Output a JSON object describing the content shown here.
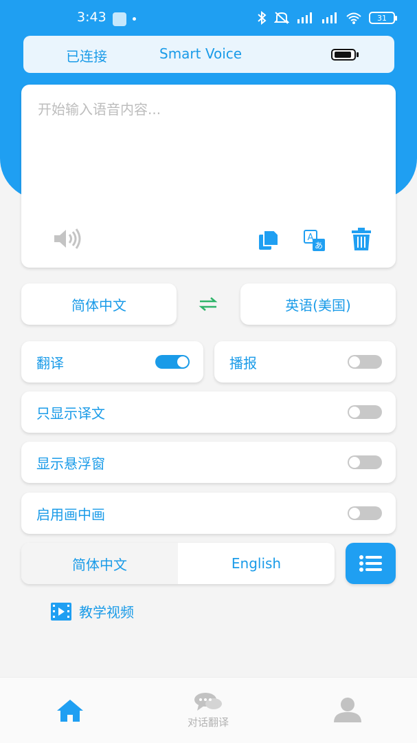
{
  "status_bar": {
    "time": "3:43",
    "battery": "31"
  },
  "header": {
    "connection_status": "已连接",
    "app_title": "Smart Voice"
  },
  "input": {
    "placeholder": "开始输入语音内容...",
    "value": ""
  },
  "languages": {
    "source": "简体中文",
    "target": "英语(美国)"
  },
  "toggles": {
    "translate": {
      "label": "翻译",
      "on": true
    },
    "broadcast": {
      "label": "播报",
      "on": false
    },
    "only_translation": {
      "label": "只显示译文",
      "on": false
    },
    "floating_window": {
      "label": "显示悬浮窗",
      "on": false
    },
    "picture_in_picture": {
      "label": "启用画中画",
      "on": false
    }
  },
  "interface_language": {
    "options": [
      "简体中文",
      "English"
    ],
    "selected": "简体中文"
  },
  "tutorial": {
    "label": "教学视频"
  },
  "bottom_nav": {
    "items": [
      {
        "label": "",
        "icon": "home-icon",
        "active": true
      },
      {
        "label": "对话翻译",
        "icon": "chat-bubbles-icon",
        "active": false
      },
      {
        "label": "",
        "icon": "user-icon",
        "active": false
      }
    ]
  },
  "colors": {
    "primary": "#1f9ff2",
    "text_primary": "#1a9be8",
    "switch_off": "#c8c8c8",
    "swap_accent": "#2fb46a",
    "inactive_nav": "#b3b3b3"
  }
}
